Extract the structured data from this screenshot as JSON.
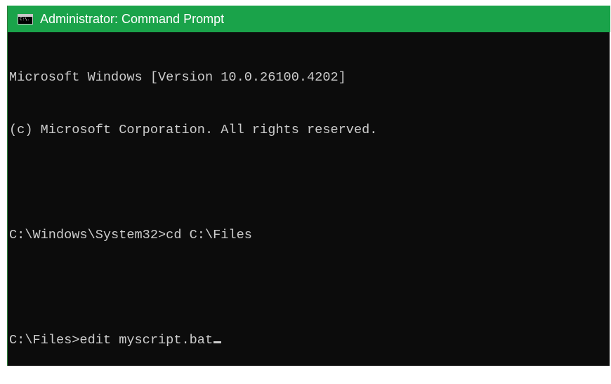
{
  "window": {
    "title": "Administrator: Command Prompt",
    "icon": "cmd-icon",
    "icon_text": "C:\\.",
    "titlebar_color": "#1aa34a",
    "background_color": "#0c0c0c",
    "text_color": "#cccccc"
  },
  "console": {
    "lines": [
      "Microsoft Windows [Version 10.0.26100.4202]",
      "(c) Microsoft Corporation. All rights reserved.",
      "",
      "C:\\Windows\\System32>cd C:\\Files",
      "",
      "C:\\Files>edit myscript.bat"
    ]
  }
}
